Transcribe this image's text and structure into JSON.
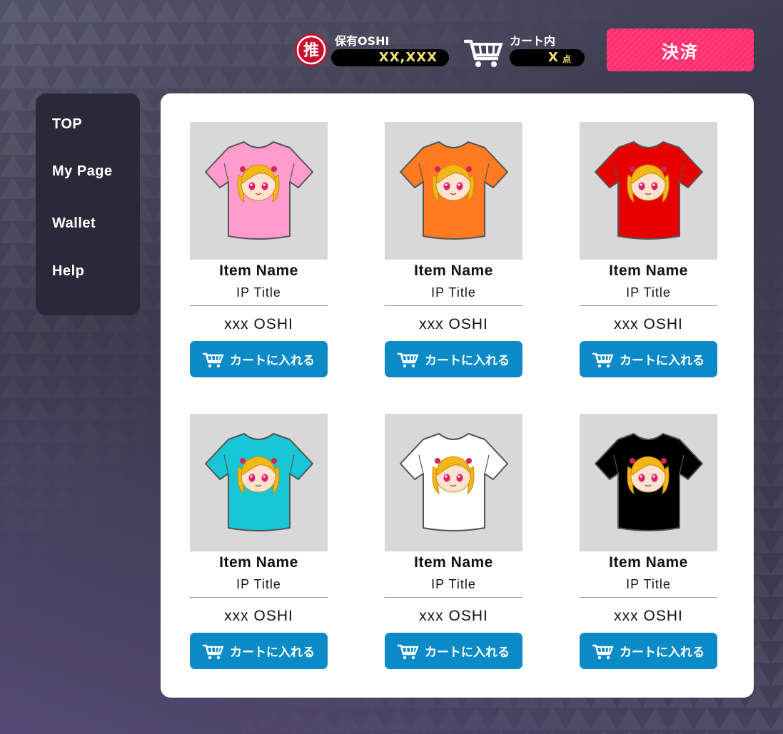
{
  "header": {
    "oshi_label": "保有OSHI",
    "oshi_value": "XX,XXX",
    "oshi_coin_glyph": "推",
    "cart_label": "カート内",
    "cart_count": "X",
    "cart_unit": "点",
    "checkout_label": "決済"
  },
  "sidebar": {
    "items": [
      {
        "label": "TOP"
      },
      {
        "label": "My Page"
      },
      {
        "label": "Wallet"
      },
      {
        "label": "Help"
      }
    ]
  },
  "products": [
    {
      "name": "Item Name",
      "ip_title": "IP Title",
      "price": "xxx OSHI",
      "cta": "カートに入れる",
      "shirt_color": "#ff9ccd"
    },
    {
      "name": "Item Name",
      "ip_title": "IP Title",
      "price": "xxx OSHI",
      "cta": "カートに入れる",
      "shirt_color": "#ff7a21"
    },
    {
      "name": "Item Name",
      "ip_title": "IP Title",
      "price": "xxx OSHI",
      "cta": "カートに入れる",
      "shirt_color": "#e60000"
    },
    {
      "name": "Item Name",
      "ip_title": "IP Title",
      "price": "xxx OSHI",
      "cta": "カートに入れる",
      "shirt_color": "#17c7d6"
    },
    {
      "name": "Item Name",
      "ip_title": "IP Title",
      "price": "xxx OSHI",
      "cta": "カートに入れる",
      "shirt_color": "#ffffff"
    },
    {
      "name": "Item Name",
      "ip_title": "IP Title",
      "price": "xxx OSHI",
      "cta": "カートに入れる",
      "shirt_color": "#000000"
    }
  ],
  "colors": {
    "background": "#3d3a4f",
    "sidebar": "#2b2838",
    "checkout": "#ff2d6e",
    "cart_button": "#0a8bc7",
    "value_text": "#f2e27a",
    "coin_red": "#c8102e"
  }
}
